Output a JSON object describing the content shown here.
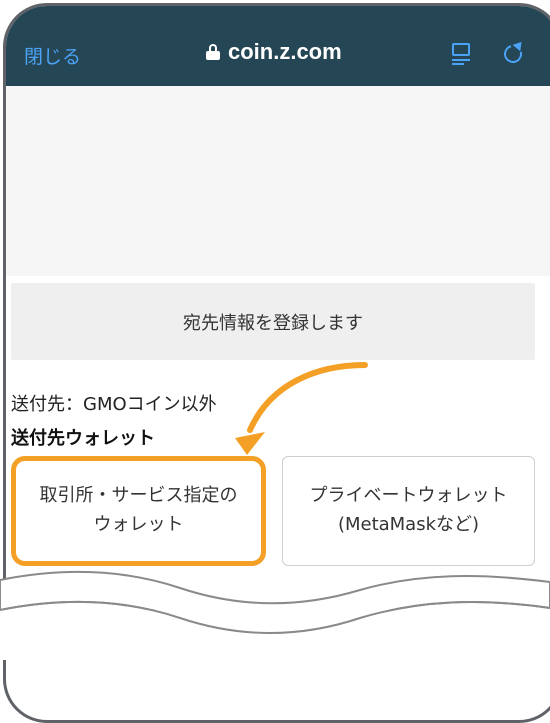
{
  "browser": {
    "close_label": "閉じる",
    "url": "coin.z.com",
    "accent": "#4aa3f5",
    "bar_color": "#254655"
  },
  "page": {
    "register_button": "宛先情報を登録します",
    "destination_text": "送付先：GMOコイン以外",
    "wallet_heading": "送付先ウォレット",
    "options": [
      {
        "label_line1": "取引所・サービス指定の",
        "label_line2": "ウォレット",
        "selected": true
      },
      {
        "label_line1": "プライベートウォレット",
        "label_line2": "(MetaMaskなど)",
        "selected": false
      }
    ]
  },
  "annotation": {
    "highlight_color": "#f4a026",
    "arrow_icon": "curved-arrow-icon"
  }
}
